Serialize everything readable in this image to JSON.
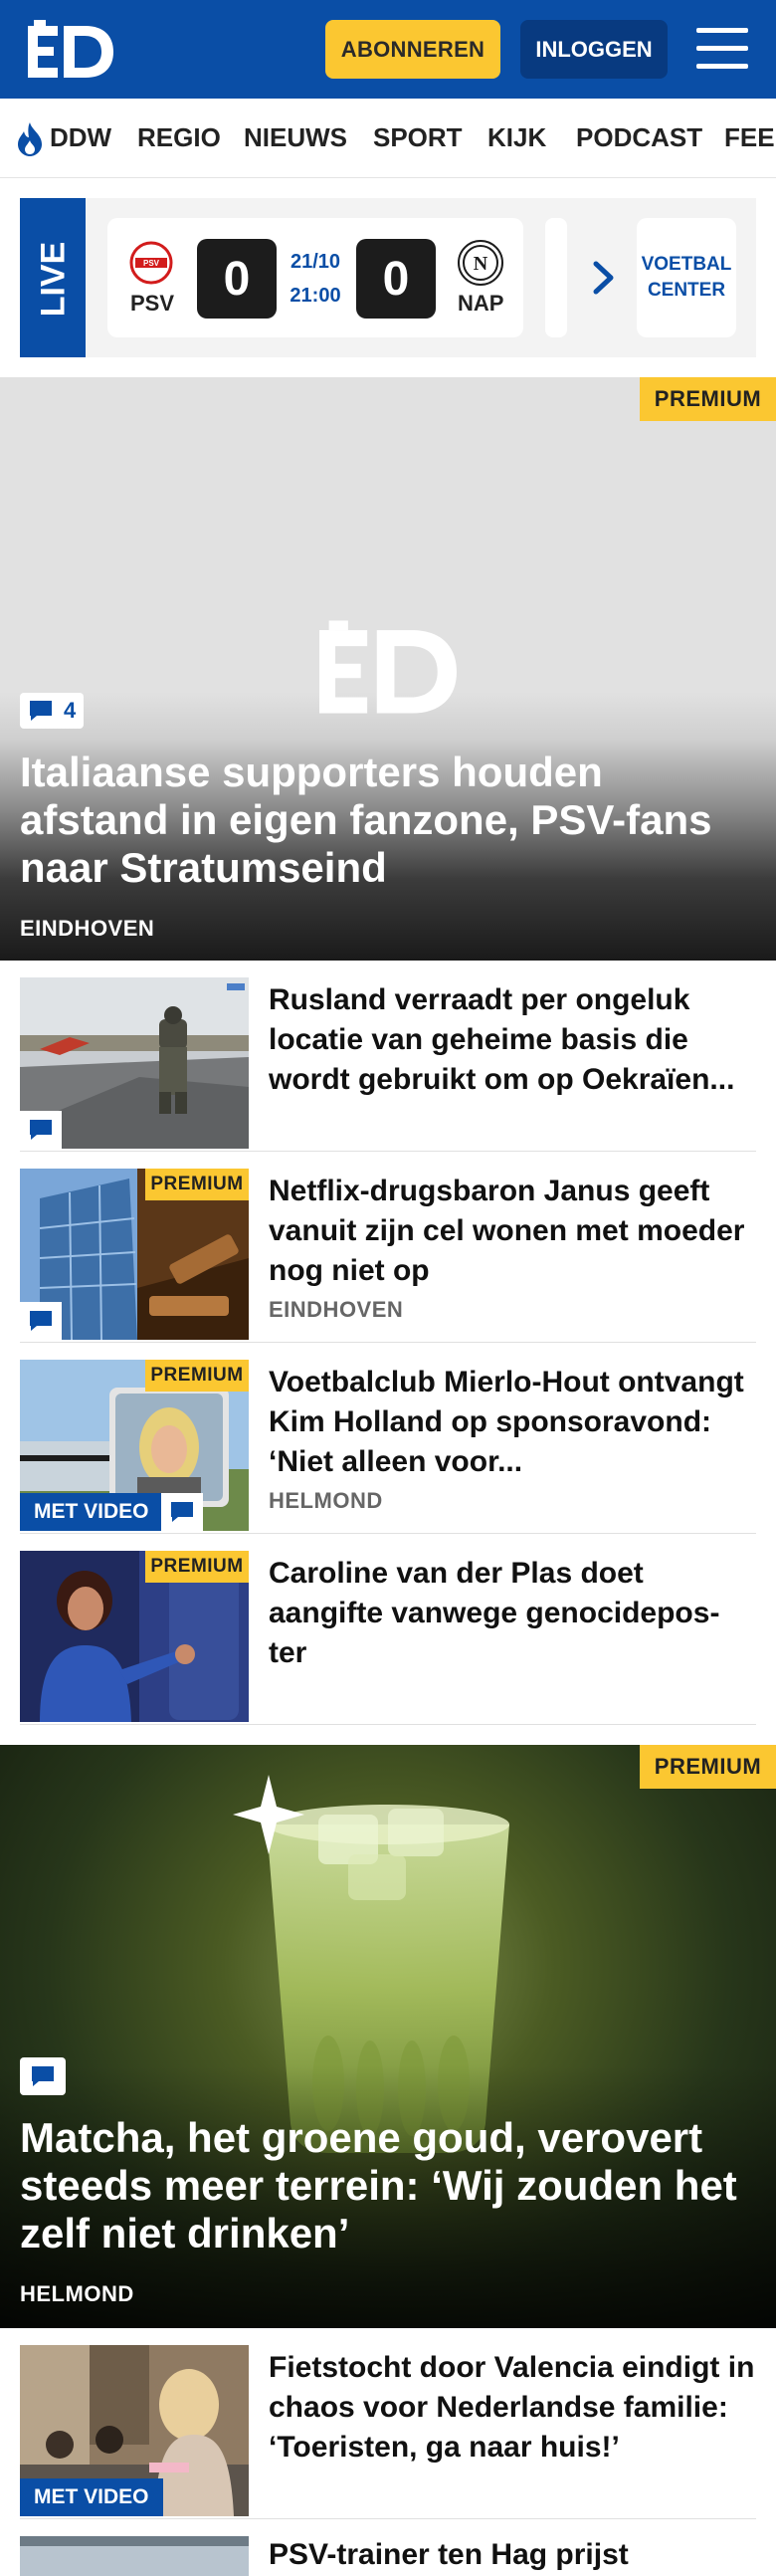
{
  "header": {
    "logo_alt": "ED",
    "subscribe_label": "ABONNEREN",
    "login_label": "INLOGGEN",
    "brand_color": "#0a4ea6",
    "accent_color": "#fbc731"
  },
  "nav": {
    "items": [
      "DDW",
      "REGIO",
      "NIEUWS",
      "SPORT",
      "KIJK",
      "PODCAST",
      "FEE"
    ]
  },
  "live": {
    "label": "LIVE",
    "home_team": "PSV",
    "away_team": "NAP",
    "home_score": "0",
    "away_score": "0",
    "date": "21/10",
    "time": "21:00",
    "voetbal_center": "VOETBAL CENTER"
  },
  "hero": {
    "premium_label": "PREMIUM",
    "comment_count": "4",
    "title": "Italiaanse supporters houden afstand in eigen fanzone, PSV-fans naar Stratumseind",
    "location": "EINDHOVEN"
  },
  "articles": [
    {
      "title": "Rusland verraadt per ongeluk locatie van geheime basis die wordt gebruikt om op Oekraïen...",
      "location": "",
      "premium": false,
      "video_label": ""
    },
    {
      "title": "Netflix-drugsbaron Janus geeft vanuit zijn cel wonen met moeder nog niet op",
      "location": "EINDHOVEN",
      "premium_label": "PREMIUM",
      "video_label": ""
    },
    {
      "title": "Voetbalclub Mierlo-Hout ontvangt Kim Holland op sponsoravond: ‘Niet alleen voor...",
      "location": "HELMOND",
      "premium_label": "PREMIUM",
      "video_label": "MET VIDEO"
    },
    {
      "title": "Caroline van der Plas doet aangifte vanwege genocidepos- ter",
      "location": "",
      "premium_label": "PREMIUM",
      "video_label": ""
    }
  ],
  "hero2": {
    "premium_label": "PREMIUM",
    "title": "Matcha, het groene goud, verovert steeds meer terrein: ‘Wij zouden het zelf niet drinken’",
    "location": "HELMOND"
  },
  "article_bottom": {
    "title": "Fietstocht door Valencia eindigt in chaos voor Nederlandse familie: ‘Toeristen, ga naar huis!’",
    "video_label": "MET VIDEO",
    "next_title_partial": "PSV-trainer ten Hag prijst"
  }
}
